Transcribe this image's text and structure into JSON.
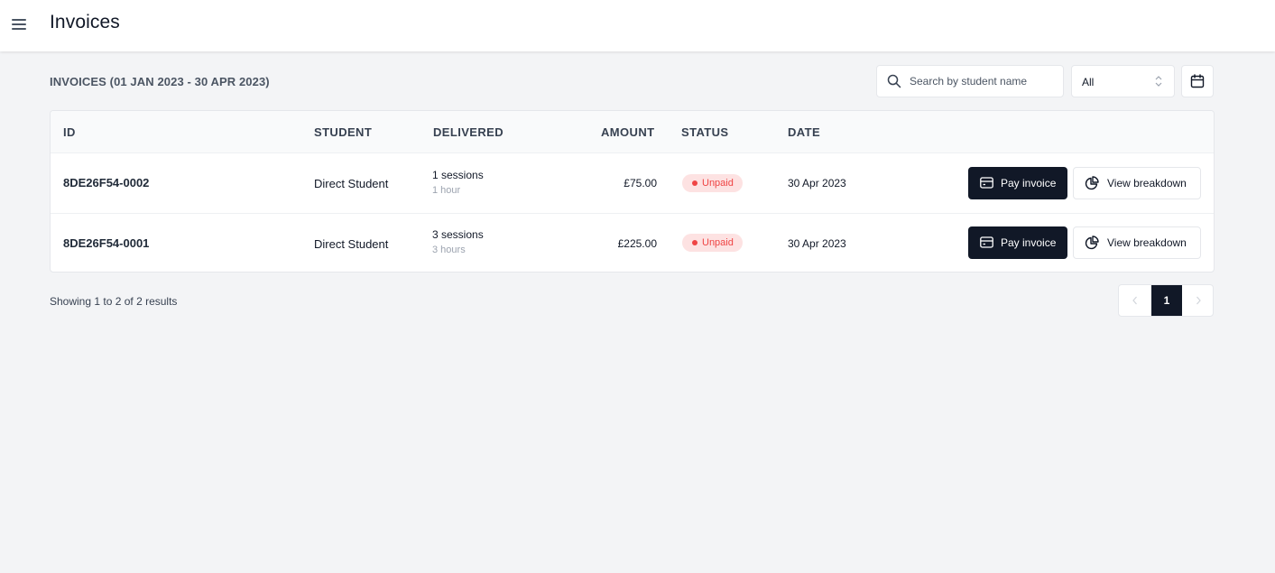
{
  "header": {
    "title": "Invoices"
  },
  "section": {
    "title": "INVOICES (01 JAN 2023 - 30 APR 2023)"
  },
  "search": {
    "placeholder": "Search by student name",
    "value": ""
  },
  "status_filter": {
    "selected": "All"
  },
  "table": {
    "columns": [
      "ID",
      "STUDENT",
      "DELIVERED",
      "AMOUNT",
      "STATUS",
      "DATE"
    ],
    "rows": [
      {
        "id": "8DE26F54-0002",
        "student": "Direct Student",
        "sessions": "1 sessions",
        "hours": "1 hour",
        "amount": "£75.00",
        "status": "Unpaid",
        "date": "30 Apr 2023",
        "pay_label": "Pay invoice",
        "view_label": "View breakdown"
      },
      {
        "id": "8DE26F54-0001",
        "student": "Direct Student",
        "sessions": "3 sessions",
        "hours": "3 hours",
        "amount": "£225.00",
        "status": "Unpaid",
        "date": "30 Apr 2023",
        "pay_label": "Pay invoice",
        "view_label": "View breakdown"
      }
    ]
  },
  "footer": {
    "results_text": "Showing 1 to 2 of 2 results"
  },
  "pagination": {
    "current_page": "1"
  },
  "colors": {
    "primary": "#111827",
    "unpaid_bg": "#fde2e2",
    "unpaid_text": "#ef4444",
    "background": "#f3f4f6"
  },
  "icons": [
    "menu-icon",
    "search-icon",
    "chevron-up-down-icon",
    "calendar-icon",
    "credit-card-icon",
    "pie-chart-icon",
    "chevron-left-icon",
    "chevron-right-icon"
  ]
}
